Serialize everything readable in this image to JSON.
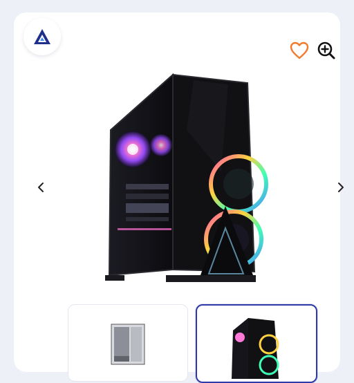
{
  "brand": {
    "logo_icon": "triangle-logo-icon",
    "color": "#1f2f8a"
  },
  "toolbar": {
    "favorite_icon": "heart-icon",
    "zoom_icon": "zoom-in-icon",
    "favorite_color": "#f07b2a"
  },
  "gallery": {
    "prev_icon": "chevron-left-icon",
    "next_icon": "chevron-right-icon",
    "image": "gaming-pc-case-rgb",
    "selected_thumbnail": 2,
    "thumbnails": [
      "pc-case-plain",
      "pc-case-rgb"
    ],
    "accent": "#2e3aa8"
  }
}
